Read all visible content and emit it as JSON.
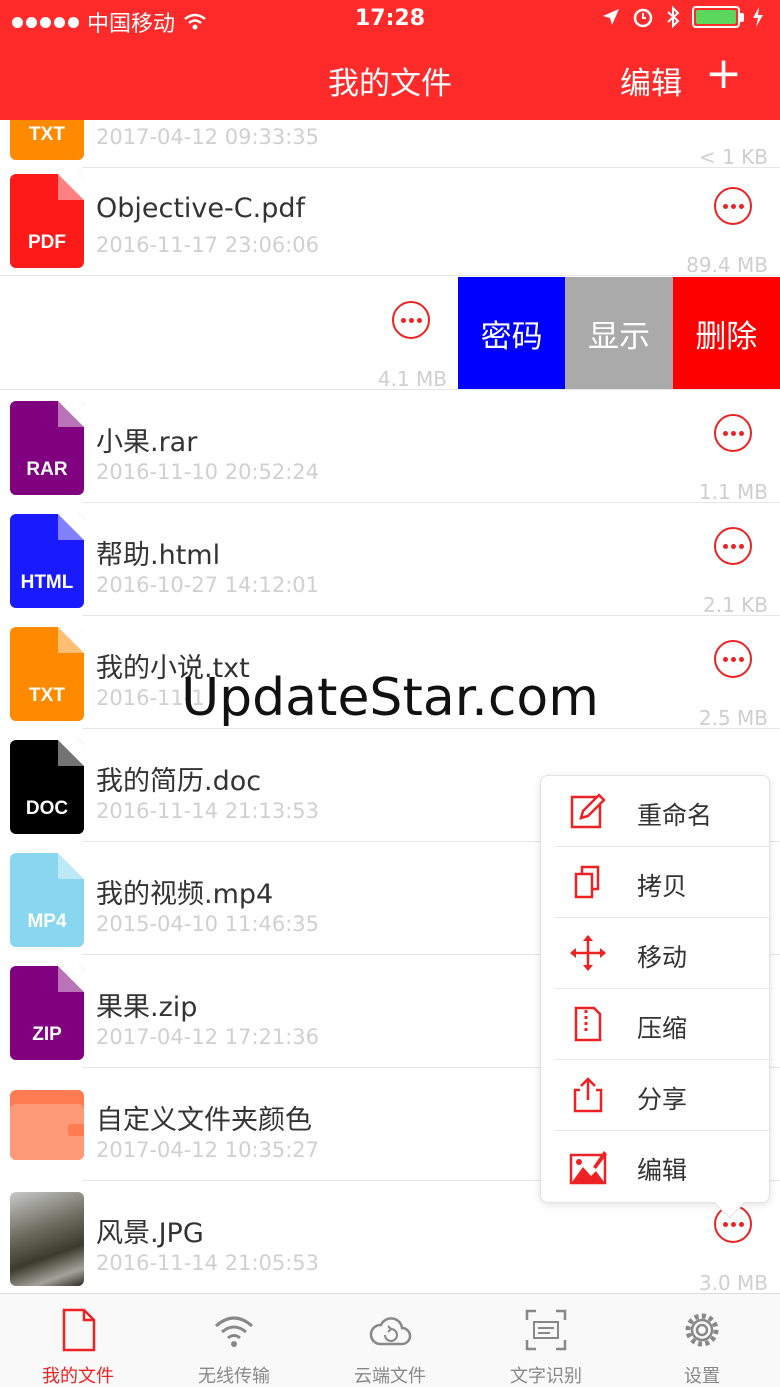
{
  "status_bar": {
    "carrier": "中国移动",
    "time": "17:28"
  },
  "nav": {
    "title": "我的文件",
    "edit_label": "编辑",
    "add_label": "+"
  },
  "files": [
    {
      "type": "TXT",
      "color": "#ff8a00",
      "name": "",
      "date": "2017-04-12 09:33:35",
      "size": "< 1 KB"
    },
    {
      "type": "PDF",
      "color": "#ff1a1a",
      "name": "Objective-C.pdf",
      "date": "2016-11-17 23:06:06",
      "size": "89.4 MB"
    },
    {
      "type": "",
      "color": "",
      "name": "",
      "date": "",
      "size": "4.1 MB"
    },
    {
      "type": "RAR",
      "color": "#800080",
      "name": "小果.rar",
      "date": "2016-11-10 20:52:24",
      "size": "1.1 MB"
    },
    {
      "type": "HTML",
      "color": "#1a1aff",
      "name": "帮助.html",
      "date": "2016-10-27 14:12:01",
      "size": "2.1 KB"
    },
    {
      "type": "TXT",
      "color": "#ff8a00",
      "name": "我的小说.txt",
      "date": "2016-11-1",
      "size": "2.5 MB"
    },
    {
      "type": "DOC",
      "color": "#000000",
      "name": "我的简历.doc",
      "date": "2016-11-14 21:13:53",
      "size": ""
    },
    {
      "type": "MP4",
      "color": "#88d6f0",
      "name": "我的视频.mp4",
      "date": "2015-04-10 11:46:35",
      "size": ""
    },
    {
      "type": "ZIP",
      "color": "#800080",
      "name": "果果.zip",
      "date": "2017-04-12 17:21:36",
      "size": ""
    },
    {
      "type": "folder",
      "color": "#ff7c52",
      "name": "自定义文件夹颜色",
      "date": "2017-04-12 10:35:27",
      "size": ""
    },
    {
      "type": "photo",
      "color": "",
      "name": "风景.JPG",
      "date": "2016-11-14 21:05:53",
      "size": "3.0 MB"
    }
  ],
  "swipe_actions": [
    {
      "label": "密码",
      "color": "#0000ff"
    },
    {
      "label": "显示",
      "color": "#aaaaaa"
    },
    {
      "label": "删除",
      "color": "#ff0000"
    }
  ],
  "popup_menu": [
    {
      "label": "重命名",
      "icon": "edit-icon"
    },
    {
      "label": "拷贝",
      "icon": "copy-icon"
    },
    {
      "label": "移动",
      "icon": "move-icon"
    },
    {
      "label": "压缩",
      "icon": "compress-icon"
    },
    {
      "label": "分享",
      "icon": "share-icon"
    },
    {
      "label": "编辑",
      "icon": "image-edit-icon"
    }
  ],
  "tabs": [
    {
      "label": "我的文件",
      "icon": "file-icon",
      "active": true
    },
    {
      "label": "无线传输",
      "icon": "wifi-icon",
      "active": false
    },
    {
      "label": "云端文件",
      "icon": "cloud-icon",
      "active": false
    },
    {
      "label": "文字识别",
      "icon": "scan-icon",
      "active": false
    },
    {
      "label": "设置",
      "icon": "gear-icon",
      "active": false
    }
  ],
  "watermark": "UpdateStar.com",
  "accent_color": "#ff2a2a"
}
